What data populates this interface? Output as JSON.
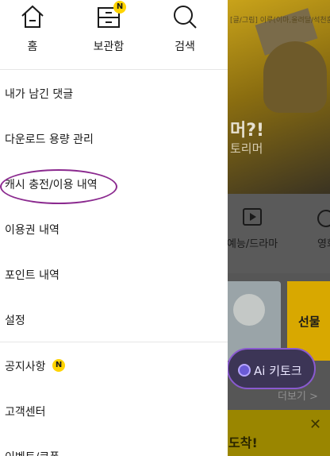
{
  "background": {
    "hero_credit": "[글/그림] 이루(이마,올려달/석천훈 회사",
    "hero_title": "머?!",
    "hero_subtitle": "토리머",
    "category_label": "예능/드라마",
    "category_label_2": "영화",
    "gift_label": "선물",
    "more_link": "더보기 >",
    "ai_button": "Ai 키토크",
    "bottom_banner": "도착!",
    "close_glyph": "✕"
  },
  "top_nav": {
    "home": "홈",
    "library": "보관함",
    "search": "검색",
    "library_badge": "N"
  },
  "menu": {
    "items": [
      "내가 남긴 댓글",
      "다운로드 용량 관리",
      "캐시 충전/이용 내역",
      "이용권 내역",
      "포인트 내역",
      "설정",
      "공지사항",
      "고객센터",
      "이벤트/쿠폰"
    ],
    "notice_badge": "N"
  },
  "colors": {
    "badge": "#ffd400",
    "annotation_circle": "#8b2a8f",
    "ai_button_border": "#8a5ad0"
  },
  "icons": [
    "home-icon",
    "library-icon",
    "search-icon"
  ]
}
